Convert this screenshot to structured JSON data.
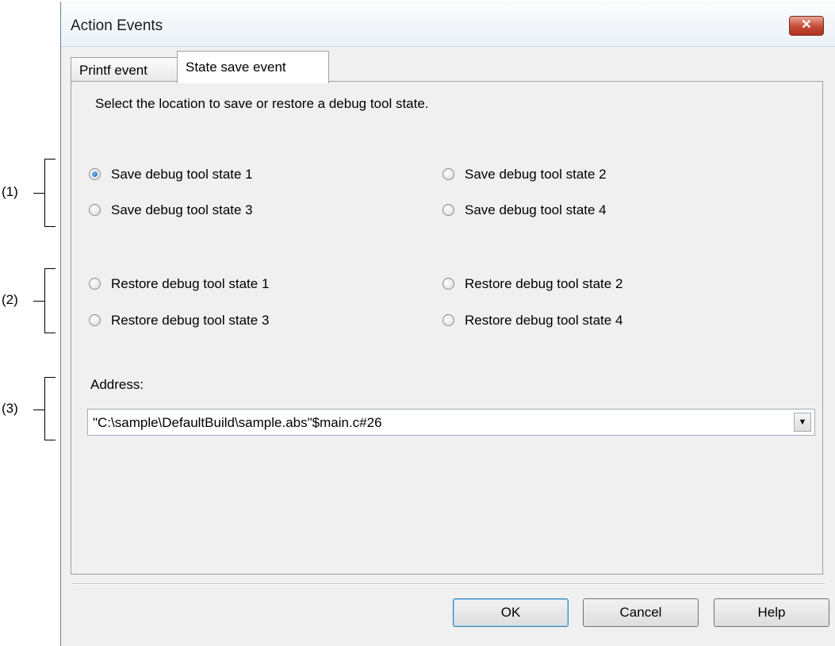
{
  "callouts": [
    "(1)",
    "(2)",
    "(3)"
  ],
  "window": {
    "title": "Action Events",
    "close_glyph": "✕"
  },
  "tabs": [
    {
      "label": "Printf event",
      "active": false
    },
    {
      "label": "State save event",
      "active": true
    }
  ],
  "panel": {
    "instruction": "Select the location to save or restore a debug tool state.",
    "save_options": [
      {
        "label": "Save debug tool state 1",
        "checked": true
      },
      {
        "label": "Save debug tool state 2",
        "checked": false
      },
      {
        "label": "Save debug tool state 3",
        "checked": false
      },
      {
        "label": "Save debug tool state 4",
        "checked": false
      }
    ],
    "restore_options": [
      {
        "label": "Restore debug tool state 1",
        "checked": false
      },
      {
        "label": "Restore debug tool state 2",
        "checked": false
      },
      {
        "label": "Restore debug tool state 3",
        "checked": false
      },
      {
        "label": "Restore debug tool state 4",
        "checked": false
      }
    ],
    "address_label": "Address:",
    "address_value": "\"C:\\sample\\DefaultBuild\\sample.abs\"$main.c#26",
    "dropdown_glyph": "▼"
  },
  "buttons": {
    "ok": "OK",
    "cancel": "Cancel",
    "help": "Help"
  }
}
